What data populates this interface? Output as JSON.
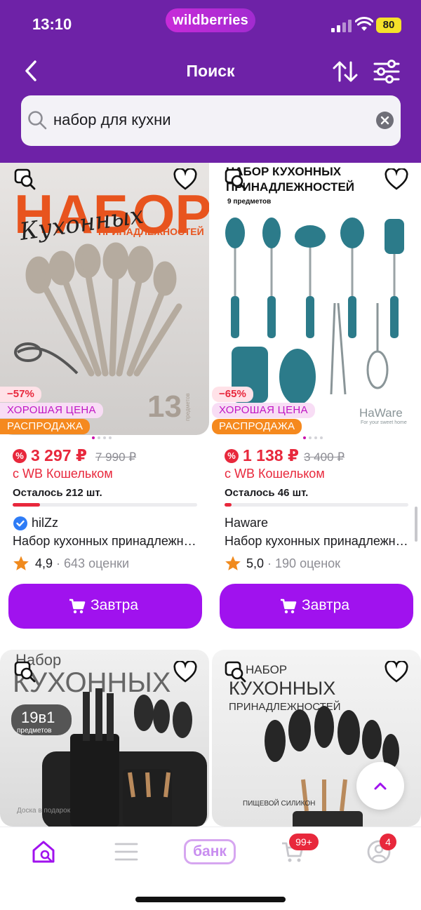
{
  "status_bar": {
    "time": "13:10",
    "brand": "wildberries",
    "battery": "80"
  },
  "header": {
    "title": "Поиск"
  },
  "search": {
    "value": "набор для кухни"
  },
  "products": [
    {
      "discount": "−57%",
      "tag_good": "ХОРОШАЯ ЦЕНА",
      "tag_sale": "РАСПРОДАЖА",
      "price": "3 297 ₽",
      "old_price": "7 990 ₽",
      "wallet": "с WB Кошельком",
      "stock": "Осталось 212 шт.",
      "stock_level": 0.15,
      "brand": "hilZz",
      "name": "Набор кухонных принадлежностей",
      "rating": "4,9",
      "reviews": "643 оценки",
      "button": "Завтра"
    },
    {
      "discount": "−65%",
      "tag_good": "ХОРОШАЯ ЦЕНА",
      "tag_sale": "РАСПРОДАЖА",
      "price": "1 138 ₽",
      "old_price": "3 400 ₽",
      "wallet": "с WB Кошельком",
      "stock": "Осталось 46 шт.",
      "stock_level": 0.04,
      "brand": "Haware",
      "name": "Набор кухонных принадлежностей",
      "rating": "5,0",
      "reviews": "190 оценок",
      "button": "Завтра"
    }
  ],
  "images": {
    "p1": {
      "title": "НАБОР",
      "script": "Кухонных",
      "subtitle": "ПРИНАДЛЕЖНОСТЕЙ",
      "count": "13",
      "count_label": "предметов"
    },
    "p2": {
      "title": "НАБОР КУХОННЫХ",
      "subtitle": "ПРИНАДЛЕЖНОСТЕЙ",
      "count": "9 предметов",
      "logo": "HaWare",
      "logo_sub": "For your sweet home"
    },
    "p3": {
      "title": "Набор",
      "subtitle": "КУХОННЫХ",
      "count": "19в1",
      "count_label": "предметов",
      "note": "Доска в подарок"
    },
    "p4": {
      "title": "НАБОР",
      "subtitle": "КУХОННЫХ",
      "sub2": "ПРИНАДЛЕЖНОСТЕЙ",
      "note": "ПИЩЕВОЙ СИЛИКОН"
    }
  },
  "nav": {
    "bank": "банк",
    "cart_badge": "99+",
    "profile_badge": "4"
  },
  "colors": {
    "header": "#6e22a7",
    "accent": "#a012ee",
    "price": "#e8283c"
  }
}
